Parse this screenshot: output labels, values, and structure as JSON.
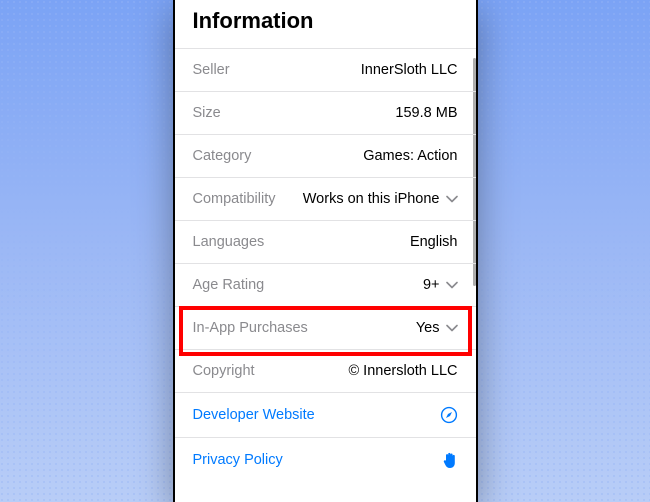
{
  "header": {
    "title": "Information"
  },
  "rows": {
    "seller": {
      "label": "Seller",
      "value": "InnerSloth LLC"
    },
    "size": {
      "label": "Size",
      "value": "159.8 MB"
    },
    "category": {
      "label": "Category",
      "value": "Games: Action"
    },
    "compatibility": {
      "label": "Compatibility",
      "value": "Works on this iPhone"
    },
    "languages": {
      "label": "Languages",
      "value": "English"
    },
    "ageRating": {
      "label": "Age Rating",
      "value": "9+"
    },
    "iap": {
      "label": "In-App Purchases",
      "value": "Yes"
    },
    "copyright": {
      "label": "Copyright",
      "value": "© Innersloth LLC"
    }
  },
  "links": {
    "developer": {
      "label": "Developer Website"
    },
    "privacy": {
      "label": "Privacy Policy"
    }
  }
}
